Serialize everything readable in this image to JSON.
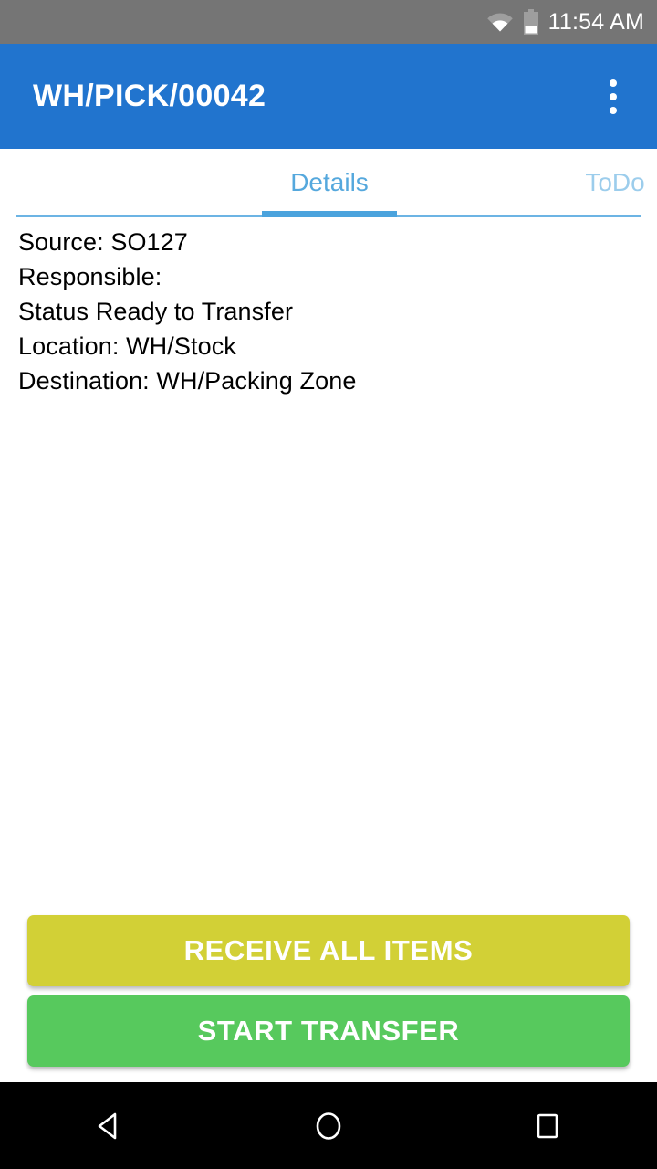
{
  "status_bar": {
    "time": "11:54 AM",
    "wifi_icon": "wifi-icon",
    "battery_icon": "battery-icon",
    "background_color": "#757575"
  },
  "app_bar": {
    "title": "WH/PICK/00042",
    "overflow_icon": "more-vertical-icon",
    "background_color": "#2174ce"
  },
  "tabs": {
    "active_index": 0,
    "items": [
      {
        "label": "Details",
        "active": true,
        "color": "#55a8dd"
      },
      {
        "label": "ToDo",
        "active": false,
        "color": "#9ccdec"
      }
    ],
    "indicator_color": "#4ba3dd",
    "baseline_color": "#6cb4e4"
  },
  "details": {
    "lines": [
      "Source: SO127",
      "Responsible:",
      "Status Ready to Transfer",
      "Location: WH/Stock",
      "Destination: WH/Packing Zone"
    ]
  },
  "actions": {
    "receive_all_label": "RECEIVE ALL ITEMS",
    "receive_all_color": "#d2d036",
    "start_transfer_label": "START TRANSFER",
    "start_transfer_color": "#57c95d"
  },
  "nav_bar": {
    "back_icon": "back-triangle-icon",
    "home_icon": "home-circle-icon",
    "recents_icon": "recents-square-icon",
    "background_color": "#000000"
  }
}
